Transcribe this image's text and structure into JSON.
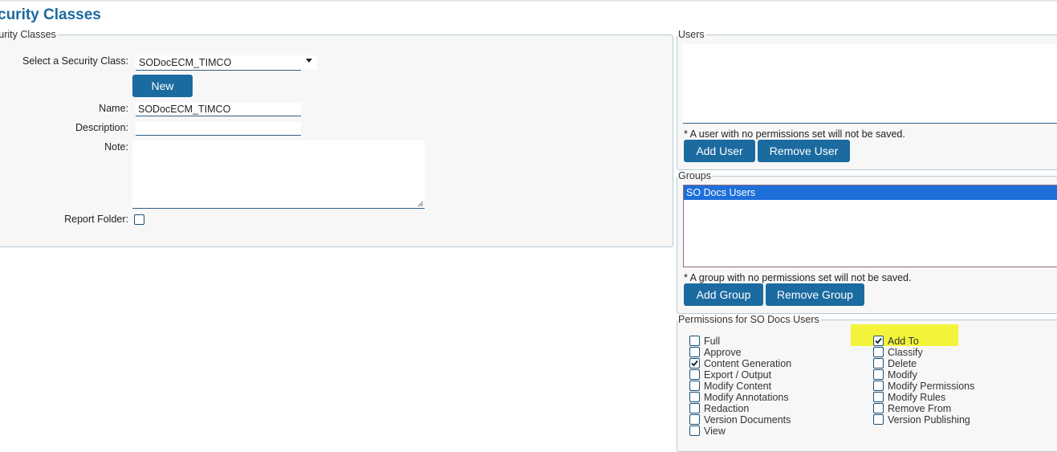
{
  "page": {
    "title": "curity Classes"
  },
  "security_classes": {
    "legend": "curity Classes",
    "select_label": "Select a Security Class:",
    "select_value": "SODocECM_TIMCO",
    "new_button": "New",
    "name_label": "Name:",
    "name_value": "SODocECM_TIMCO",
    "description_label": "Description:",
    "description_value": "",
    "note_label": "Note:",
    "note_value": "",
    "report_folder_label": "Report Folder:",
    "report_folder_checked": false
  },
  "users": {
    "legend": "Users",
    "items": [],
    "hint": "* A user with no permissions set will not be saved.",
    "add_button": "Add User",
    "remove_button": "Remove User"
  },
  "groups": {
    "legend": "Groups",
    "items": [
      {
        "label": "SO Docs Users",
        "selected": true
      }
    ],
    "hint": "* A group with no permissions set will not be saved.",
    "add_button": "Add Group",
    "remove_button": "Remove Group"
  },
  "permissions": {
    "legend": "Permissions for SO Docs Users",
    "left": [
      {
        "label": "Full",
        "checked": false
      },
      {
        "label": "Approve",
        "checked": false
      },
      {
        "label": "Content Generation",
        "checked": true
      },
      {
        "label": "Export / Output",
        "checked": false
      },
      {
        "label": "Modify Content",
        "checked": false
      },
      {
        "label": "Modify Annotations",
        "checked": false
      },
      {
        "label": "Redaction",
        "checked": false
      },
      {
        "label": "Version Documents",
        "checked": false
      },
      {
        "label": "View",
        "checked": false
      }
    ],
    "right": [
      {
        "label": "Add To",
        "checked": true,
        "highlighted": true
      },
      {
        "label": "Classify",
        "checked": false
      },
      {
        "label": "Delete",
        "checked": false
      },
      {
        "label": "Modify",
        "checked": false
      },
      {
        "label": "Modify Permissions",
        "checked": false
      },
      {
        "label": "Modify Rules",
        "checked": false
      },
      {
        "label": "Remove From",
        "checked": false
      },
      {
        "label": "Version Publishing",
        "checked": false
      }
    ]
  },
  "colors": {
    "accent": "#1b6aa0",
    "selection": "#1e6fd9",
    "highlight": "#f3f43a"
  }
}
